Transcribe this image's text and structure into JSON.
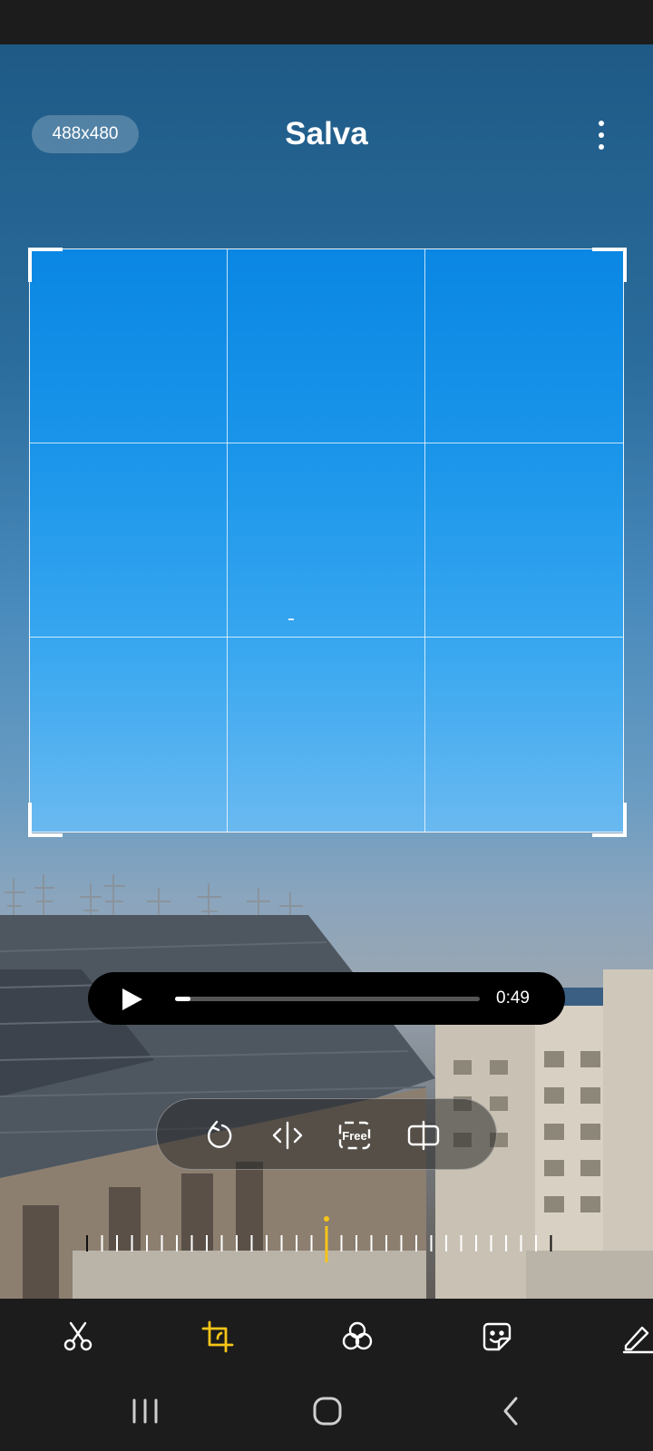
{
  "header": {
    "dimensions": "488x480",
    "save_label": "Salva"
  },
  "player": {
    "duration": "0:49",
    "progress": 0.05
  },
  "tools": [
    "rotate",
    "flip",
    "free-aspect",
    "mirror"
  ],
  "bottom_tabs": {
    "items": [
      "trim",
      "crop",
      "filters",
      "stickers",
      "draw"
    ],
    "active": "crop"
  },
  "colors": {
    "accent": "#f5c518",
    "crop_fill_top": "#0a87e3",
    "crop_fill_bottom": "#6ab9f0"
  }
}
